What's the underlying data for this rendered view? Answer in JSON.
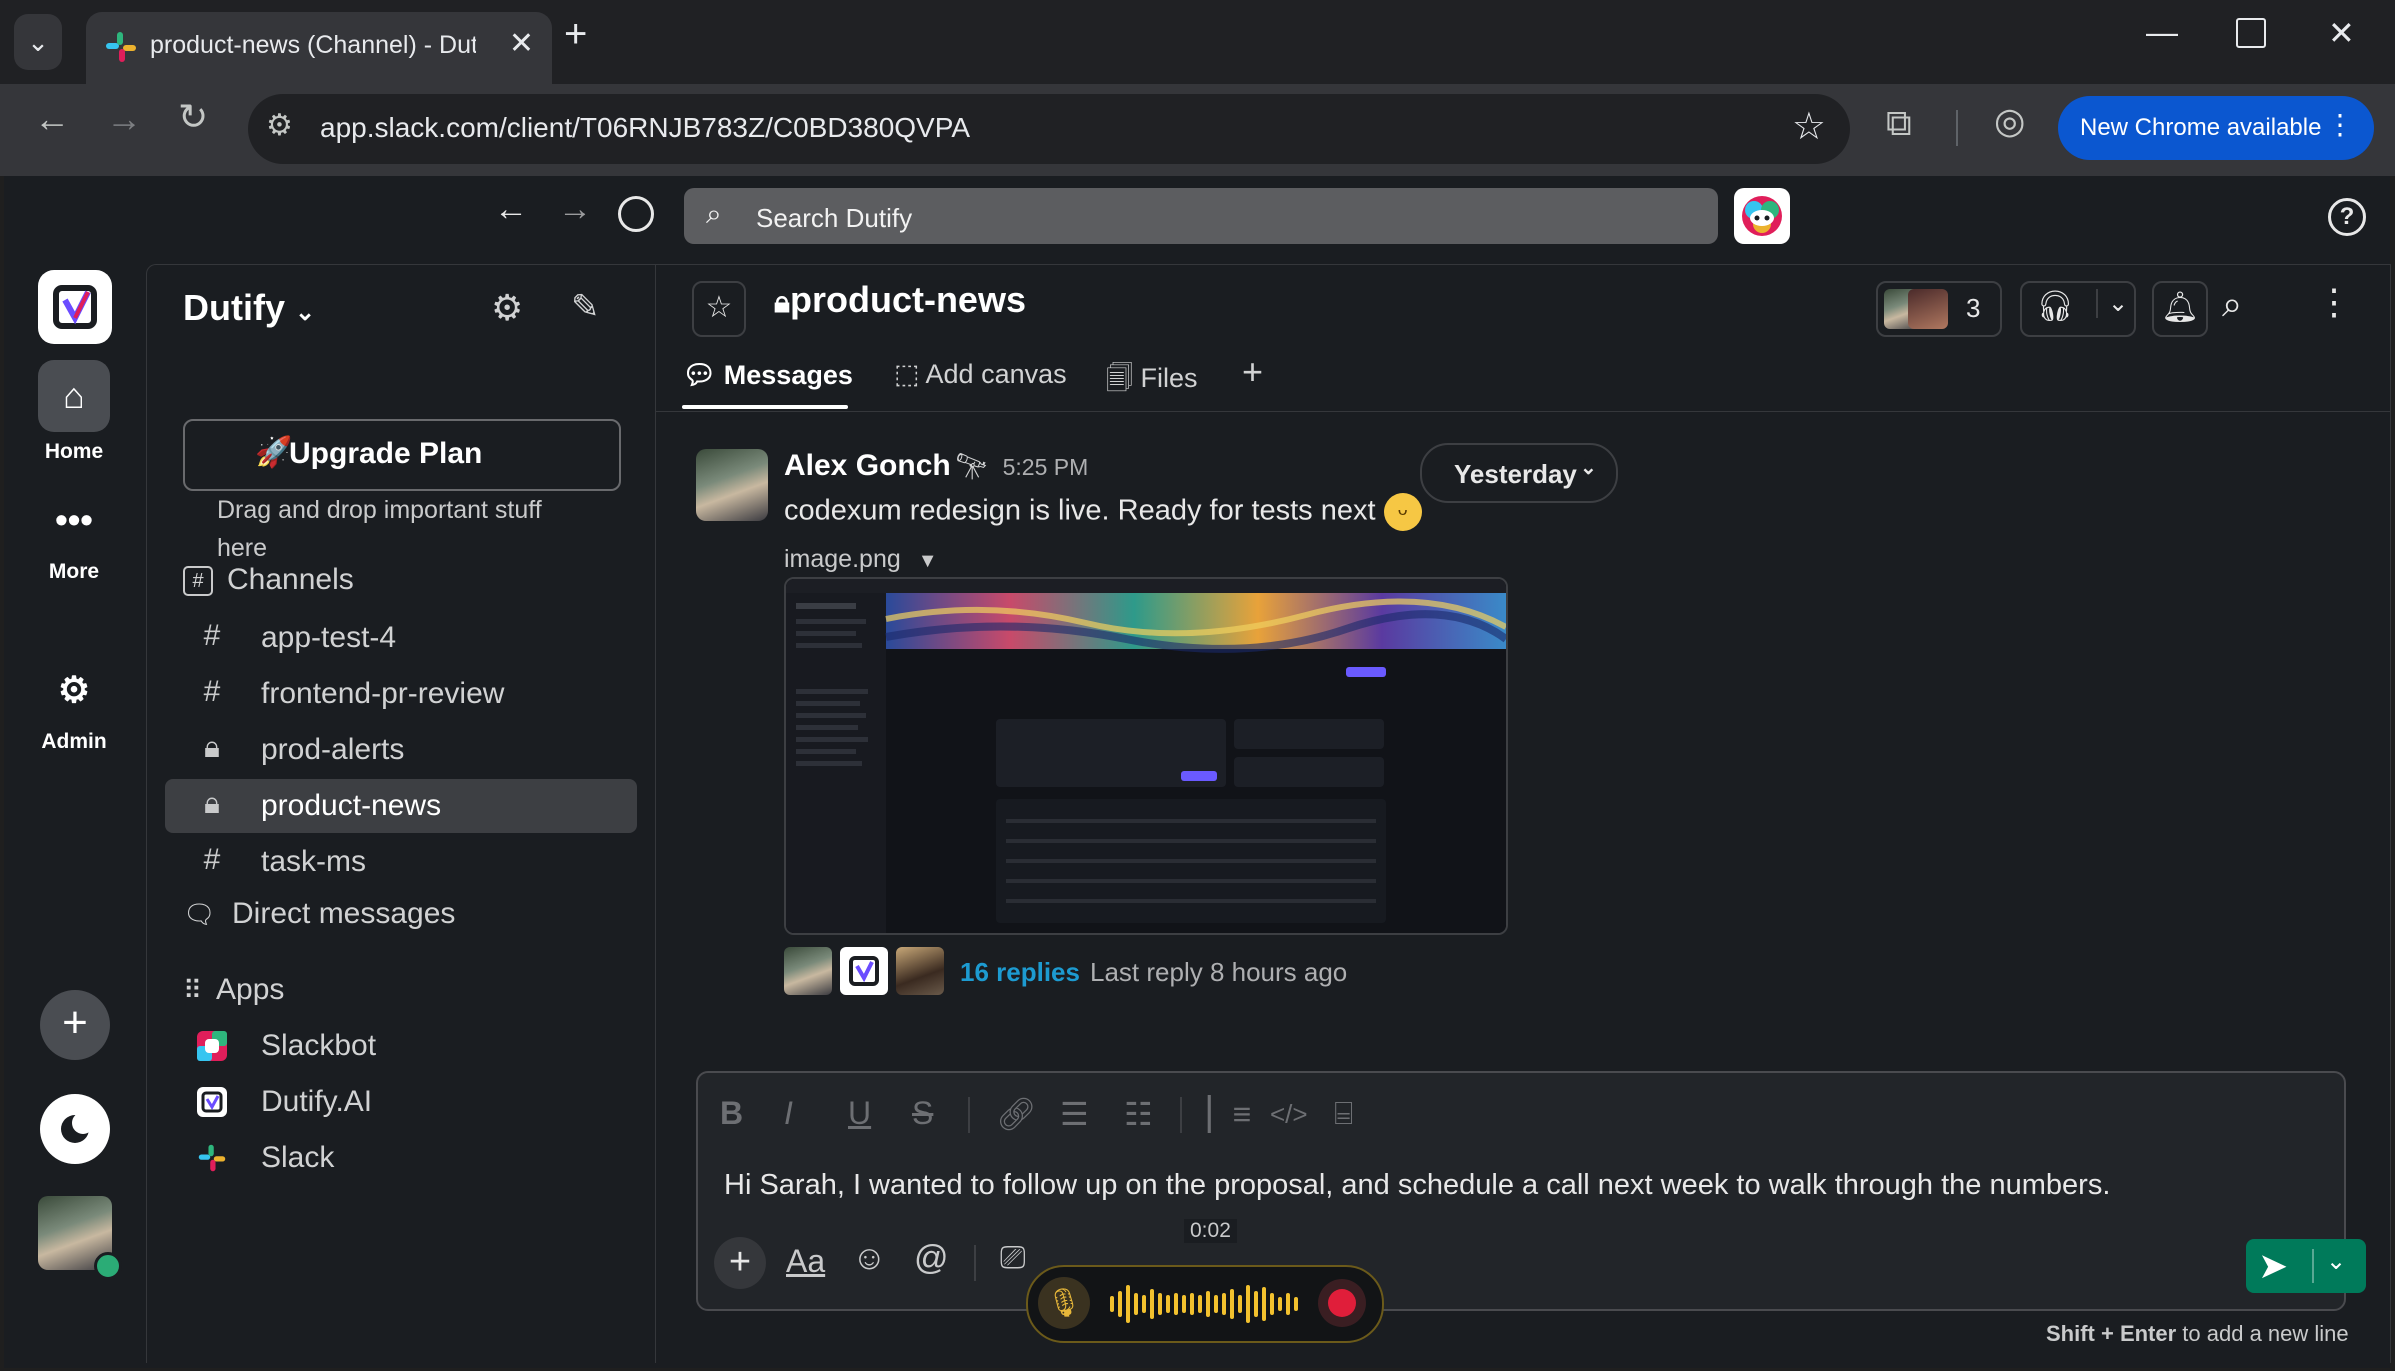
{
  "browser": {
    "tab_title": "product-news (Channel) - Dutify",
    "url": "app.slack.com/client/T06RNJB783Z/C0BD380QVPA",
    "update_button": "New Chrome available"
  },
  "slack": {
    "search_placeholder": "Search Dutify",
    "rail": {
      "home": "Home",
      "more": "More",
      "admin": "Admin"
    },
    "workspace": "Dutify",
    "upgrade_label": "Upgrade Plan",
    "tip_text": "Drag and drop important stuff here",
    "channels_header": "Channels",
    "channels": [
      {
        "name": "app-test-4",
        "icon": "hash-icon"
      },
      {
        "name": "frontend-pr-review",
        "icon": "hash-icon"
      },
      {
        "name": "prod-alerts",
        "icon": "lock-icon"
      },
      {
        "name": "product-news",
        "icon": "lock-icon",
        "active": true
      },
      {
        "name": "task-ms",
        "icon": "hash-icon"
      }
    ],
    "dm_header": "Direct messages",
    "apps_header": "Apps",
    "apps": [
      {
        "name": "Slackbot"
      },
      {
        "name": "Dutify.AI"
      },
      {
        "name": "Slack"
      }
    ],
    "channel": {
      "name": "product-news",
      "member_count": "3",
      "tabs": {
        "messages": "Messages",
        "canvas": "Add canvas",
        "files": "Files"
      }
    },
    "message": {
      "author": "Alex Gonch",
      "time": "5:25 PM",
      "text": "codexum redesign is live. Ready for tests next",
      "date_divider": "Yesterday",
      "attachment_name": "image.png",
      "replies": "16 replies",
      "last_reply": "Last reply 8 hours ago"
    },
    "composer": {
      "draft": "Hi Sarah, I wanted to follow up on the proposal, and schedule a call next week to walk through the numbers.",
      "format_label": "Aa",
      "recording_time": "0:02",
      "hint_bold": "Shift + Enter",
      "hint_rest": " to add a new line"
    }
  },
  "colors": {
    "accent_send": "#007a5a",
    "link": "#1d9bd1",
    "chrome_update": "#0b57d0"
  }
}
